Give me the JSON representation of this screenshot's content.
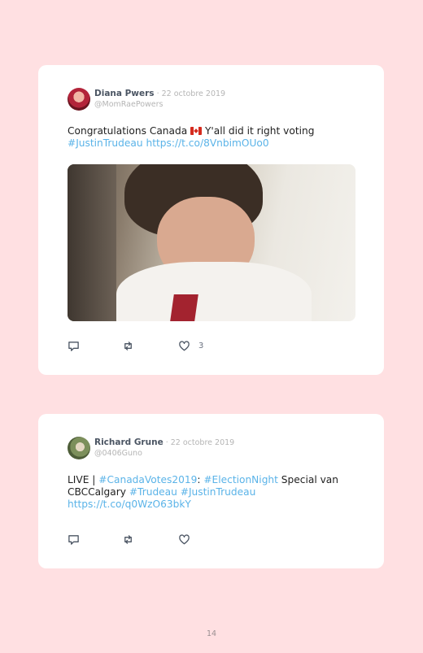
{
  "tweets": [
    {
      "name": "Diana Pwers",
      "sep": " · ",
      "date": "22 octobre 2019",
      "handle": "@MomRaePowers",
      "text_a": "Congratulations Canada ",
      "text_b": " Y'all did it right voting",
      "hashtag": "#JustinTrudeau",
      "url": "https://t.co/8VnbimOUo0",
      "likes": "3"
    },
    {
      "name": "Richard Grune",
      "sep": " · ",
      "date": "22 octobre 2019",
      "handle": "@0406Guno",
      "text_a": "LIVE | ",
      "hashtag1": "#CanadaVotes2019",
      "text_b": ": ",
      "hashtag2": "#ElectionNight",
      "text_c": " Special van CBCCalgary ",
      "hashtag3": "#Trudeau",
      "hashtag4": "#JustinTrudeau",
      "url": "https://t.co/q0WzO63bkY"
    }
  ],
  "page_number": "14",
  "icons": {
    "reply": "reply-icon",
    "retweet": "retweet-icon",
    "like": "heart-icon",
    "flag": "canada-flag-icon"
  },
  "colors": {
    "background": "#ffe0e2",
    "link": "#5ab3e8",
    "card": "#ffffff"
  }
}
